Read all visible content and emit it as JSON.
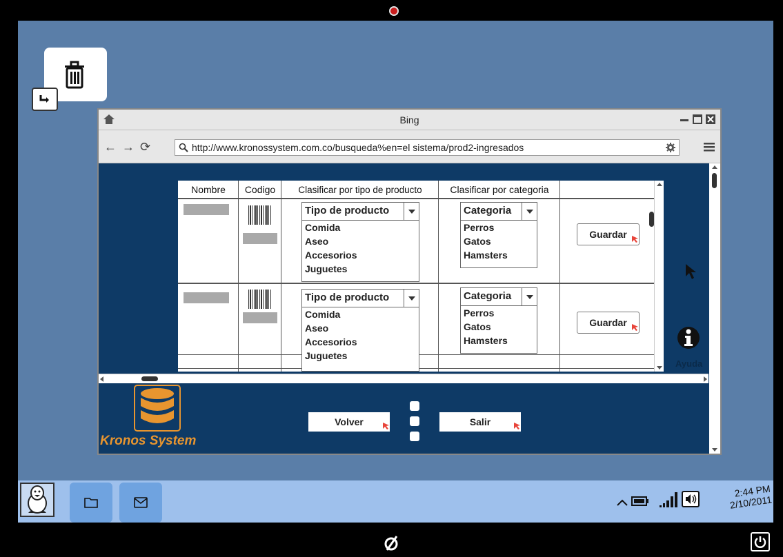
{
  "browser": {
    "title": "Bing",
    "url": "http://www.kronossystem.com.co/busqueda%en=el sistema/prod2-ingresados"
  },
  "table": {
    "headers": [
      "Nombre",
      "Codigo",
      "Clasificar por tipo de producto",
      "Clasificar por categoria",
      ""
    ],
    "rows": [
      {
        "tipo_select": "Tipo de producto",
        "tipo_options": [
          "Comida",
          "Aseo",
          "Accesorios",
          "Juguetes"
        ],
        "cat_select": "Categoria",
        "cat_options": [
          "Perros",
          "Gatos",
          "Hamsters"
        ],
        "save_label": "Guardar"
      },
      {
        "tipo_select": "Tipo de producto",
        "tipo_options": [
          "Comida",
          "Aseo",
          "Accesorios",
          "Juguetes"
        ],
        "cat_select": "Categoria",
        "cat_options": [
          "Perros",
          "Gatos",
          "Hamsters"
        ],
        "save_label": "Guardar"
      }
    ]
  },
  "help_label": "Ayuda",
  "brand": "Kronos System",
  "footer": {
    "back_label": "Volver",
    "exit_label": "Salir"
  },
  "clock": {
    "time": "2:44 PM",
    "date": "2/10/2011"
  },
  "colors": {
    "desktop": "#5a7ea8",
    "app_bg": "#0e3a66",
    "brand": "#e8952f",
    "taskbar": "#9ec0ec"
  }
}
